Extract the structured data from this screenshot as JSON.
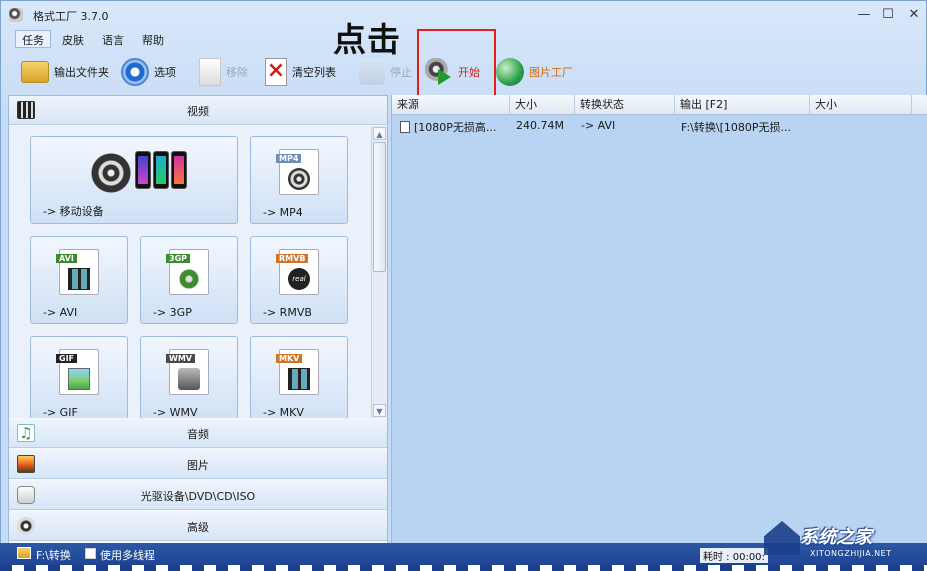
{
  "window": {
    "title": "格式工厂 3.7.0",
    "controls": {
      "minimize": "—",
      "maximize": "☐",
      "close": "✕"
    }
  },
  "menu": {
    "items": [
      {
        "label": "任务",
        "active": true
      },
      {
        "label": "皮肤"
      },
      {
        "label": "语言"
      },
      {
        "label": "帮助"
      }
    ]
  },
  "annotation": {
    "text": "点击",
    "box_color": "#e0201b"
  },
  "toolbar": {
    "output_folder": "输出文件夹",
    "options": "选项",
    "remove": "移除",
    "clear_list": "清空列表",
    "stop": "停止",
    "start": "开始",
    "picture_factory": "图片工厂"
  },
  "categories": {
    "video": "视频",
    "audio": "音频",
    "image": "图片",
    "rom": "光驱设备\\DVD\\CD\\ISO",
    "advanced": "高级"
  },
  "video_tiles": [
    {
      "label": "-> 移动设备"
    },
    {
      "label": "-> MP4",
      "tag": "MP4",
      "tag_color": "#6b8db8"
    },
    {
      "label": "-> AVI",
      "tag": "AVI",
      "tag_color": "#3b8a2d"
    },
    {
      "label": "-> 3GP",
      "tag": "3GP",
      "tag_color": "#3f8b2f"
    },
    {
      "label": "-> RMVB",
      "tag": "RMVB",
      "tag_color": "#d07528"
    },
    {
      "label": "-> GIF",
      "tag": "GIF",
      "tag_color": "#222222"
    },
    {
      "label": "-> WMV",
      "tag": "WMV",
      "tag_color": "#4a4a4a"
    },
    {
      "label": "-> MKV",
      "tag": "MKV",
      "tag_color": "#d07528"
    }
  ],
  "file_list": {
    "columns": [
      "来源",
      "大小",
      "转换状态",
      "输出 [F2]",
      "大小"
    ],
    "rows": [
      {
        "source": "[1080P无损高...",
        "size": "240.74M",
        "status": "-> AVI",
        "output": "F:\\转换\\[1080P无损...",
        "out_size": ""
      }
    ]
  },
  "statusbar": {
    "output_path": "F:\\转换",
    "multithread_label": "使用多线程",
    "multithread_checked": false,
    "elapsed": "耗时 : 00:00:"
  },
  "watermark": {
    "title": "系统之家",
    "url": "XITONGZHIJIA.NET"
  }
}
